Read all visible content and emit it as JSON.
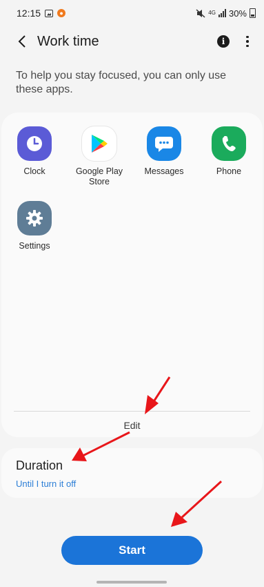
{
  "status_bar": {
    "time": "12:15",
    "network": "4G",
    "battery": "30%"
  },
  "header": {
    "title": "Work time"
  },
  "intro_text": "To help you stay focused, you can only use these apps.",
  "apps": [
    {
      "label": "Clock",
      "icon": "clock-icon",
      "color": "#5b5bd6"
    },
    {
      "label": "Google Play Store",
      "icon": "play-store-icon",
      "color": "#ffffff"
    },
    {
      "label": "Messages",
      "icon": "messages-icon",
      "color": "#1a87e6"
    },
    {
      "label": "Phone",
      "icon": "phone-icon",
      "color": "#1bab5c"
    },
    {
      "label": "Settings",
      "icon": "gear-icon",
      "color": "#5f7d96"
    }
  ],
  "edit_label": "Edit",
  "duration": {
    "title": "Duration",
    "value": "Until I turn it off"
  },
  "start_label": "Start",
  "colors": {
    "accent": "#1b74d8",
    "link": "#2c7ed6",
    "annotation_arrow": "#e8161a"
  }
}
